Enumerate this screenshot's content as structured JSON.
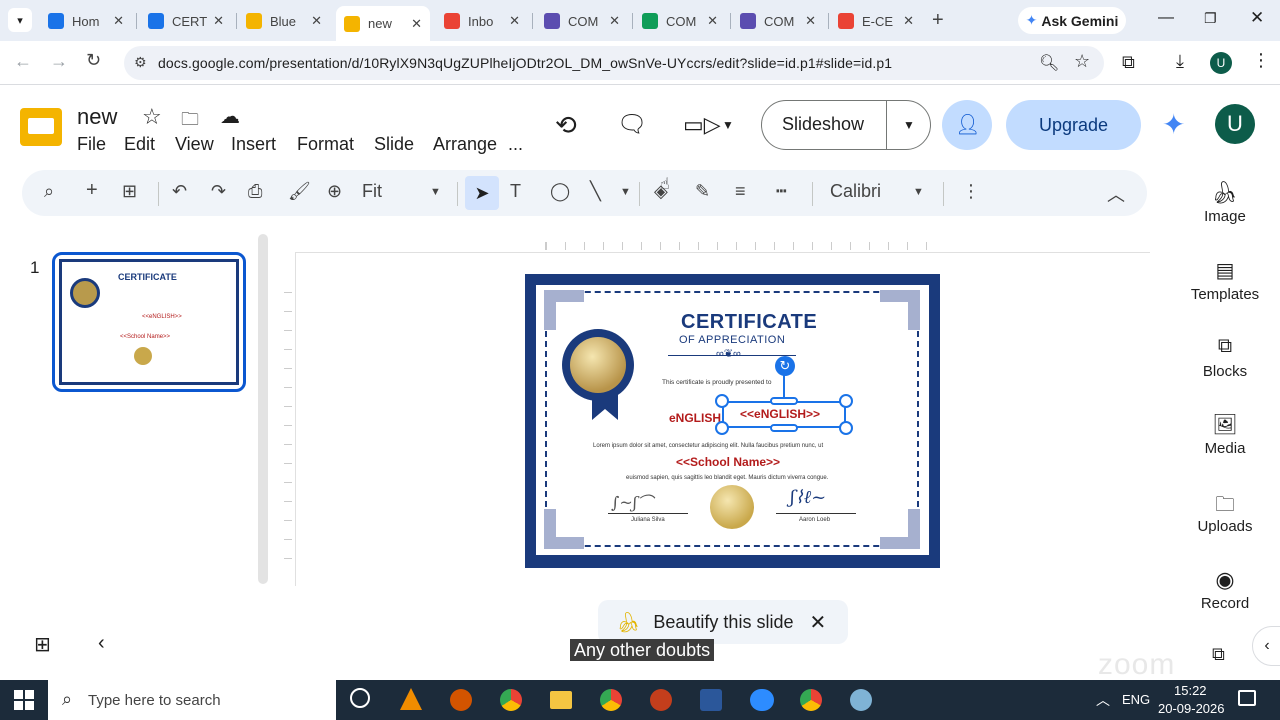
{
  "browser": {
    "tabs": [
      {
        "title": "Hom",
        "color": "#1a73e8",
        "active": false
      },
      {
        "title": "CERT",
        "color": "#1a73e8",
        "active": false
      },
      {
        "title": "Blue",
        "color": "#f4b400",
        "active": false
      },
      {
        "title": "new",
        "color": "#f4b400",
        "active": true
      },
      {
        "title": "Inbo",
        "color": "#ea4335",
        "active": false
      },
      {
        "title": "COM",
        "color": "#5b4db0",
        "active": false
      },
      {
        "title": "COM",
        "color": "#0f9d58",
        "active": false
      },
      {
        "title": "COM",
        "color": "#5b4db0",
        "active": false
      },
      {
        "title": "E-CE",
        "color": "#ea4335",
        "active": false
      }
    ],
    "ask_gemini": "Ask Gemini",
    "url": "docs.google.com/presentation/d/10RylX9N3qUgZUPlheIjODtr2OL_DM_owSnVe-UYccrs/edit?slide=id.p1#slide=id.p1",
    "profile_initial": "U"
  },
  "docs": {
    "doc_title": "new",
    "menus": [
      "File",
      "Edit",
      "View",
      "Insert",
      "Format",
      "Slide",
      "Arrange",
      "..."
    ],
    "slideshow_label": "Slideshow",
    "upgrade_label": "Upgrade",
    "account_initial": "U",
    "zoom_label": "Fit",
    "font_label": "Calibri"
  },
  "side_panel": {
    "items": [
      "Image",
      "Templates",
      "Blocks",
      "Media",
      "Uploads",
      "Record"
    ]
  },
  "filmstrip": {
    "slide_number": "1"
  },
  "slide": {
    "title": "CERTIFICATE",
    "subtitle": "OF APPRECIATION",
    "presented_text": "This certificate is proudly presented to",
    "name_left": "eNGLISH",
    "name_box": "<<eNGLISH>>",
    "lorem_1": "Lorem ipsum dolor sit amet, consectetur adipiscing elit. Nulla faucibus pretium nunc, ut",
    "school": "<<School Name>>",
    "lorem_2": "euismod sapien, quis sagittis leo blandit eget. Mauris dictum viverra congue.",
    "signer_left": "Juliana Silva",
    "signer_right": "Aaron Loeb"
  },
  "beautify_label": "Beautify this slide",
  "caption_text": "Any other doubts",
  "taskbar": {
    "search_placeholder": "Type here to search",
    "language": "ENG",
    "time": "15:22",
    "date": "20-09-2026"
  }
}
